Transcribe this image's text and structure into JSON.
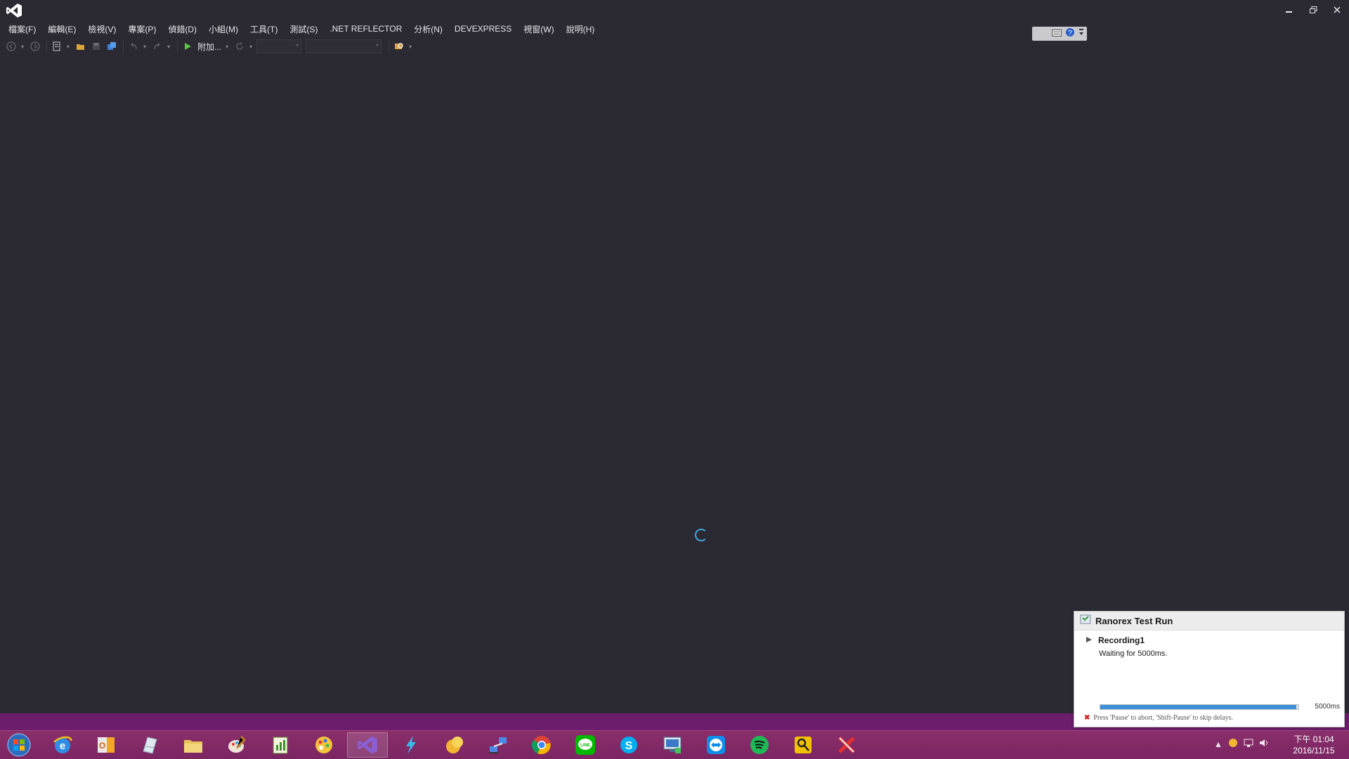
{
  "menu": [
    "檔案(F)",
    "編輯(E)",
    "檢視(V)",
    "專案(P)",
    "偵錯(D)",
    "小組(M)",
    "工具(T)",
    "測試(S)",
    ".NET REFLECTOR",
    "分析(N)",
    "DEVEXPRESS",
    "視窗(W)",
    "說明(H)"
  ],
  "toolbar": {
    "attach_label": "附加..."
  },
  "ranorex": {
    "title": "Ranorex Test Run",
    "recording": "Recording1",
    "status": "Waiting for 5000ms.",
    "duration": "5000ms",
    "progress": 0.99,
    "hint": "Press 'Pause' to abort, 'Shift-Pause' to skip delays."
  },
  "taskbar": {
    "apps": [
      "internet-explorer",
      "outlook",
      "notepad",
      "file-explorer",
      "paint",
      "project-app",
      "paint-palette",
      "visual-studio",
      "lightning-app",
      "coin-app",
      "network-app",
      "chrome",
      "line",
      "skype",
      "remote-desktop",
      "teamviewer",
      "spotify",
      "key-app",
      "cross-app"
    ],
    "active_app": "visual-studio"
  },
  "clock": {
    "time": "下午 01:04",
    "date": "2016/11/15"
  },
  "colors": {
    "ide_background": "#2b2a33",
    "taskbar": "#7b2563",
    "purple_bar": "#6c1d6c",
    "progress": "#3d8fd8",
    "spinner": "#3fa9e0"
  }
}
